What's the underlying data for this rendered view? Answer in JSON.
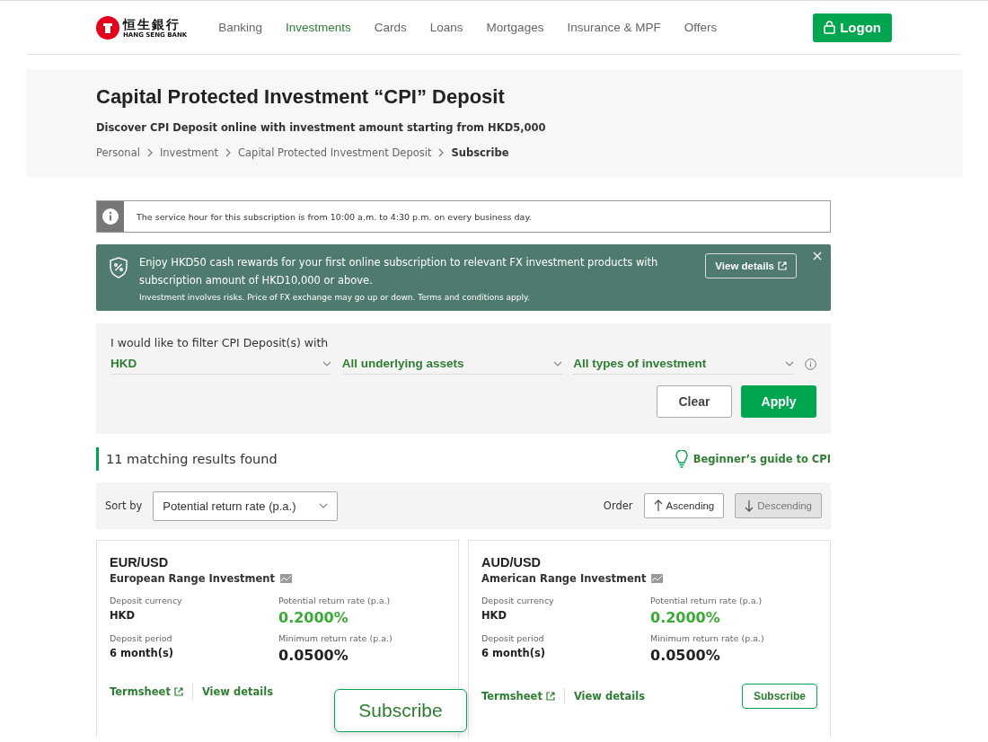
{
  "header": {
    "logo_chinese": "恒生銀行",
    "logo_english": "HANG SENG BANK",
    "nav": [
      {
        "label": "Banking",
        "selected": false
      },
      {
        "label": "Investments",
        "selected": true
      },
      {
        "label": "Cards",
        "selected": false
      },
      {
        "label": "Loans",
        "selected": false
      },
      {
        "label": "Mortgages",
        "selected": false
      },
      {
        "label": "Insurance & MPF",
        "selected": false
      },
      {
        "label": "Offers",
        "selected": false
      }
    ],
    "logon_button": "Logon"
  },
  "hero": {
    "title": "Capital Protected Investment “CPI” Deposit",
    "subtitle": "Discover CPI Deposit online with investment amount starting from HKD5,000",
    "breadcrumb": [
      {
        "label": "Personal",
        "current": false
      },
      {
        "label": "Investment",
        "current": false
      },
      {
        "label": "Capital Protected Investment Deposit",
        "current": false
      },
      {
        "label": "Subscribe",
        "current": true
      }
    ]
  },
  "notice": {
    "text": "The service hour for this subscription is from 10:00 a.m. to 4:30 p.m. on every business day."
  },
  "promo": {
    "text": "Enjoy HKD50 cash rewards for your first online subscription to relevant FX investment products with subscription amount of HKD10,000 or above.",
    "disclaimer": "Investment involves risks. Price of FX exchange may go up or down. Terms and conditions apply.",
    "button": "View details"
  },
  "filter": {
    "label": "I would like to filter CPI Deposit(s) with",
    "selects": [
      "HKD",
      "All underlying assets",
      "All types of investment"
    ],
    "clear_button": "Clear",
    "apply_button": "Apply"
  },
  "results": {
    "count": "11 matching results found",
    "guide_link": "Beginner’s guide to CPI"
  },
  "sort": {
    "label": "Sort by",
    "value": "Potential return rate (p.a.)",
    "order_label": "Order",
    "orders": [
      {
        "label": "Ascending",
        "kind": "up",
        "selected": false
      },
      {
        "label": "Descending",
        "kind": "down",
        "selected": true
      }
    ]
  },
  "cards": [
    {
      "pair": "EUR/USD",
      "product": "European Range Investment",
      "fields": [
        {
          "label": "Deposit currency",
          "value": "HKD",
          "kind": "plain"
        },
        {
          "label": "Potential return rate (p.a.)",
          "value": "0.2000%",
          "kind": "highlight"
        },
        {
          "label": "Deposit period",
          "value": "6 month(s)",
          "kind": "plain"
        },
        {
          "label": "Minimum return rate (p.a.)",
          "value": "0.0500%",
          "kind": "large"
        }
      ],
      "termsheet": "Termsheet",
      "details": "View details",
      "subscribe": "Subscribe",
      "magnified": true
    },
    {
      "pair": "AUD/USD",
      "product": "American Range Investment",
      "fields": [
        {
          "label": "Deposit currency",
          "value": "HKD",
          "kind": "plain"
        },
        {
          "label": "Potential return rate (p.a.)",
          "value": "0.2000%",
          "kind": "highlight"
        },
        {
          "label": "Deposit period",
          "value": "6 month(s)",
          "kind": "plain"
        },
        {
          "label": "Minimum return rate (p.a.)",
          "value": "0.0500%",
          "kind": "large"
        }
      ],
      "termsheet": "Termsheet",
      "details": "View details",
      "subscribe": "Subscribe",
      "magnified": false
    }
  ]
}
